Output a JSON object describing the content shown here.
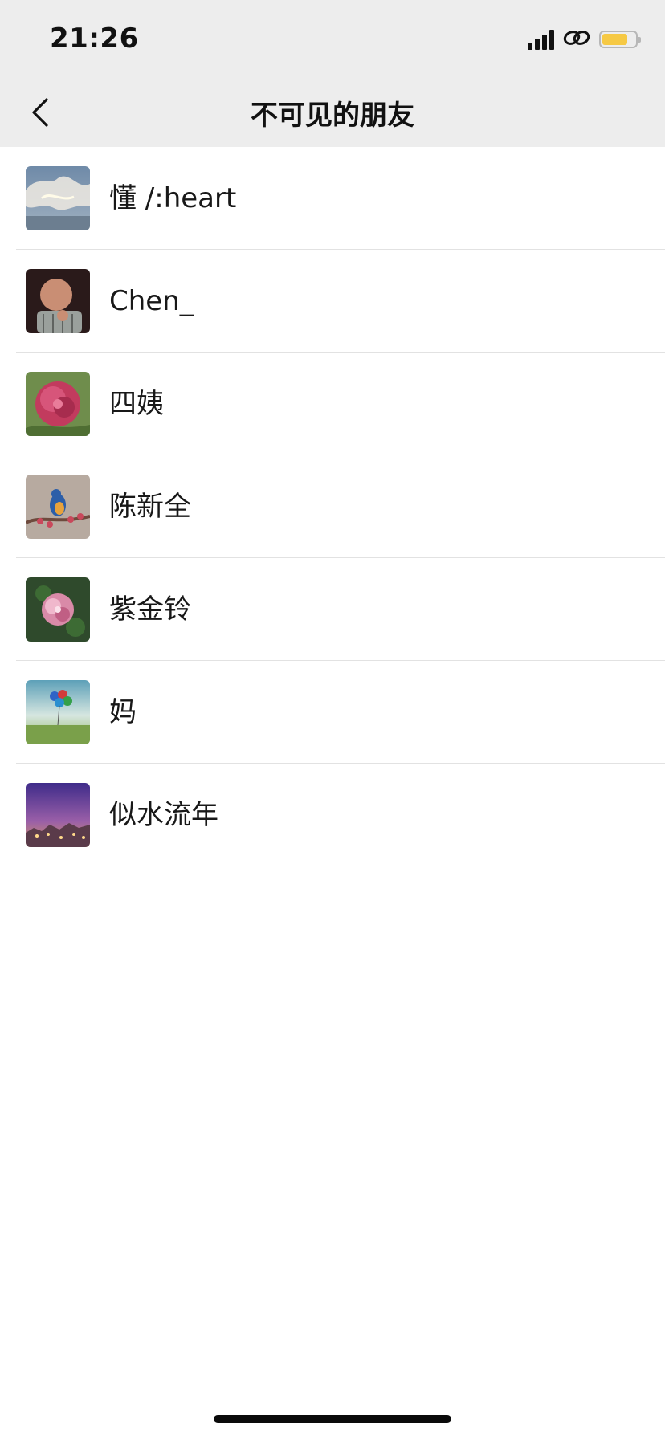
{
  "status_bar": {
    "time": "21:26",
    "icons": [
      "signal-icon",
      "link-icon",
      "battery-icon"
    ],
    "battery_color": "#f6c944"
  },
  "nav": {
    "back_icon": "chevron-left-icon",
    "title": "不可见的朋友"
  },
  "friends": [
    {
      "name": "懂 /:heart",
      "avatar": "sky-clouds-avatar"
    },
    {
      "name": "Chen_",
      "avatar": "cartoon-man-avatar"
    },
    {
      "name": "四姨",
      "avatar": "peony-flower-avatar"
    },
    {
      "name": "陈新全",
      "avatar": "bird-branch-avatar"
    },
    {
      "name": "紫金铃",
      "avatar": "pink-flower-avatar"
    },
    {
      "name": "妈",
      "avatar": "balloons-field-avatar"
    },
    {
      "name": "似水流年",
      "avatar": "sunset-town-avatar"
    }
  ],
  "colors": {
    "header_bg": "#ededed",
    "divider": "#e2e2e2",
    "text": "#181818"
  }
}
